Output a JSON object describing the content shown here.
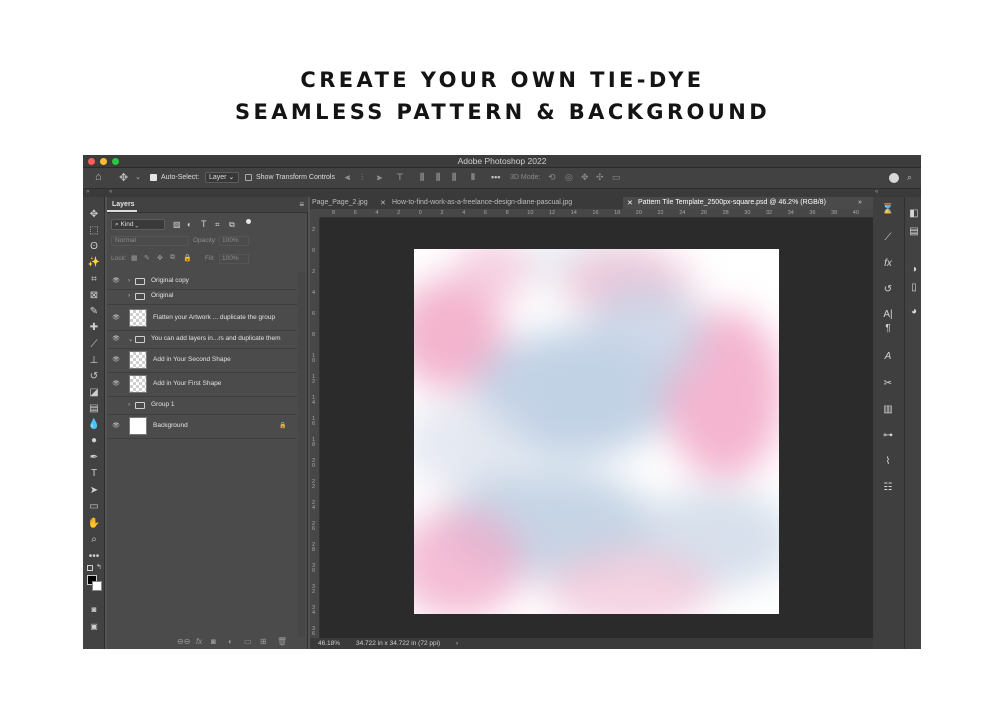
{
  "headline": {
    "line1": "CREATE YOUR OWN TIE-DYE",
    "line2": "SEAMLESS PATTERN & BACKGROUND"
  },
  "app": {
    "title": "Adobe Photoshop 2022"
  },
  "options_bar": {
    "auto_select_label": "Auto-Select:",
    "auto_select_value": "Layer",
    "transform_controls_label": "Show Transform Controls",
    "mode_3d_label": "3D Mode:"
  },
  "layers_panel": {
    "tab_label": "Layers",
    "filter_kind": "Kind",
    "blend_mode": "Normal",
    "opacity_label": "Opacity:",
    "opacity_value": "100%",
    "lock_label": "Lock:",
    "fill_label": "Fill:",
    "fill_value": "100%",
    "layers": [
      {
        "name": "Original  copy",
        "type": "group",
        "visible": true
      },
      {
        "name": "Original",
        "type": "group",
        "visible": false
      },
      {
        "name": "Flatten your Artwork ... duplicate the group",
        "type": "layer",
        "visible": true
      },
      {
        "name": "You can add layers in...rs and duplicate them",
        "type": "group-open",
        "visible": true
      },
      {
        "name": "Add in Your Second Shape",
        "type": "layer",
        "visible": true
      },
      {
        "name": "Add in Your First Shape",
        "type": "layer",
        "visible": true
      },
      {
        "name": "Group 1",
        "type": "group",
        "visible": false
      },
      {
        "name": "Background",
        "type": "background",
        "visible": true
      }
    ]
  },
  "document_tabs": [
    "Page_Page_2.jpg",
    "How-to-find-work-as-a-freelance-design-diane-pascual.jpg",
    "Pattern Tile Template_2500px-square.psd @ 46.2% (RGB/8)"
  ],
  "ruler_h": [
    "8",
    "6",
    "4",
    "2",
    "0",
    "2",
    "4",
    "6",
    "8",
    "10",
    "12",
    "14",
    "16",
    "18",
    "20",
    "22",
    "24",
    "26",
    "28",
    "30",
    "32",
    "34",
    "36",
    "38",
    "40",
    "42"
  ],
  "ruler_v": [
    "2",
    "0",
    "2",
    "4",
    "6",
    "8",
    "1\n0",
    "1\n2",
    "1\n4",
    "1\n6",
    "1\n8",
    "2\n0",
    "2\n2",
    "2\n4",
    "2\n6",
    "2\n8",
    "3\n0",
    "3\n2",
    "3\n4",
    "3\n6"
  ],
  "status": {
    "zoom": "46.18%",
    "doc_info": "34.722 in x 34.722 in (72 ppi)"
  },
  "colors": {
    "pink": "#f2a9c7",
    "blue": "#b6c9de"
  }
}
